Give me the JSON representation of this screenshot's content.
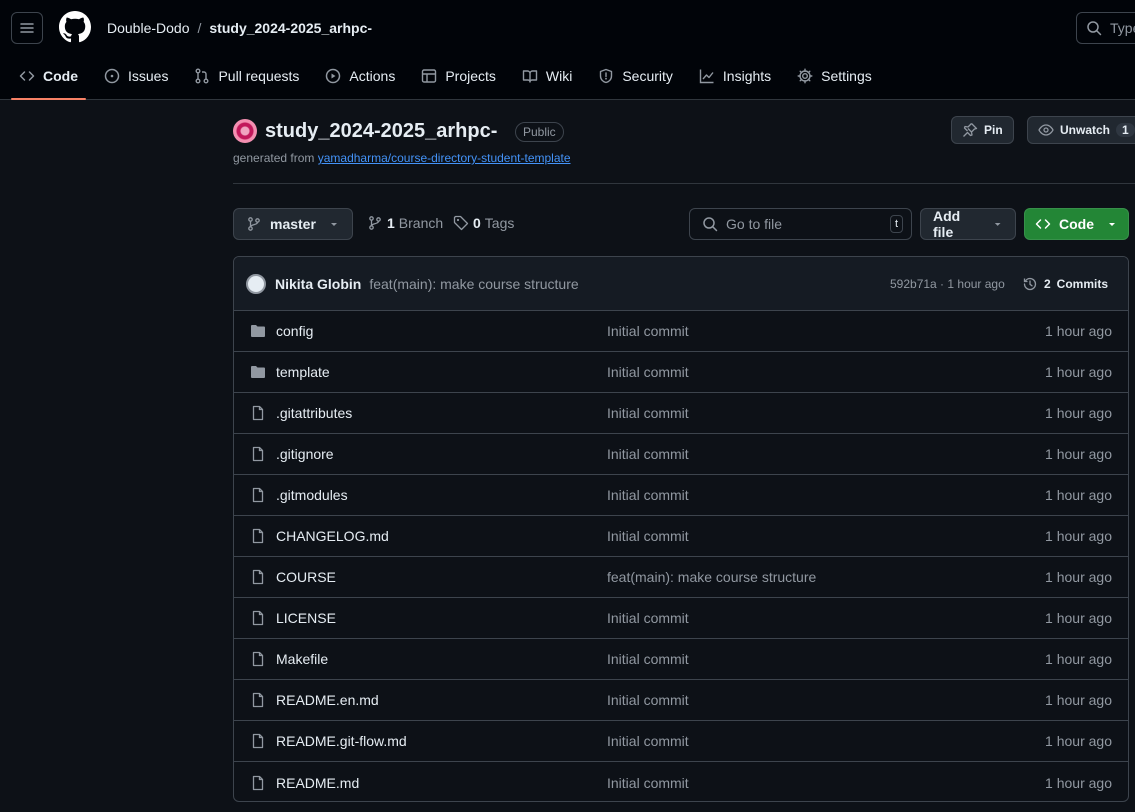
{
  "header": {
    "owner": "Double-Dodo",
    "separator": "/",
    "repo": "study_2024-2025_arhpc-",
    "search_placeholder": "Type"
  },
  "tabs": [
    {
      "label": "Code",
      "icon": "code-icon"
    },
    {
      "label": "Issues",
      "icon": "issue-icon"
    },
    {
      "label": "Pull requests",
      "icon": "pull-request-icon"
    },
    {
      "label": "Actions",
      "icon": "play-icon"
    },
    {
      "label": "Projects",
      "icon": "table-icon"
    },
    {
      "label": "Wiki",
      "icon": "book-icon"
    },
    {
      "label": "Security",
      "icon": "shield-icon"
    },
    {
      "label": "Insights",
      "icon": "graph-icon"
    },
    {
      "label": "Settings",
      "icon": "gear-icon"
    }
  ],
  "repo": {
    "title": "study_2024-2025_arhpc-",
    "visibility": "Public",
    "generated_prefix": "generated from",
    "template_link": "yamadharma/course-directory-student-template",
    "pin_label": "Pin",
    "unwatch_label": "Unwatch",
    "watch_count": "1"
  },
  "toolbar": {
    "branch": "master",
    "branch_count": "1",
    "branch_word": "Branch",
    "tag_count": "0",
    "tag_word": "Tags",
    "goto_placeholder": "Go to file",
    "goto_shortcut": "t",
    "add_file": "Add file",
    "code": "Code"
  },
  "commit": {
    "author": "Nikita Globin",
    "message": "feat(main): make course structure",
    "meta": "592b71a · 1 hour ago",
    "commits_count": "2",
    "commits_word": "Commits"
  },
  "files": [
    {
      "name": "config",
      "type": "folder",
      "message": "Initial commit",
      "time": "1 hour ago"
    },
    {
      "name": "template",
      "type": "folder",
      "message": "Initial commit",
      "time": "1 hour ago"
    },
    {
      "name": ".gitattributes",
      "type": "file",
      "message": "Initial commit",
      "time": "1 hour ago"
    },
    {
      "name": ".gitignore",
      "type": "file",
      "message": "Initial commit",
      "time": "1 hour ago"
    },
    {
      "name": ".gitmodules",
      "type": "file",
      "message": "Initial commit",
      "time": "1 hour ago"
    },
    {
      "name": "CHANGELOG.md",
      "type": "file",
      "message": "Initial commit",
      "time": "1 hour ago"
    },
    {
      "name": "COURSE",
      "type": "file",
      "message": "feat(main): make course structure",
      "time": "1 hour ago"
    },
    {
      "name": "LICENSE",
      "type": "file",
      "message": "Initial commit",
      "time": "1 hour ago"
    },
    {
      "name": "Makefile",
      "type": "file",
      "message": "Initial commit",
      "time": "1 hour ago"
    },
    {
      "name": "README.en.md",
      "type": "file",
      "message": "Initial commit",
      "time": "1 hour ago"
    },
    {
      "name": "README.git-flow.md",
      "type": "file",
      "message": "Initial commit",
      "time": "1 hour ago"
    },
    {
      "name": "README.md",
      "type": "file",
      "message": "Initial commit",
      "time": "1 hour ago"
    }
  ],
  "colors": {
    "accent_tab": "#f78166",
    "link": "#4493f8",
    "code_button": "#238636"
  }
}
